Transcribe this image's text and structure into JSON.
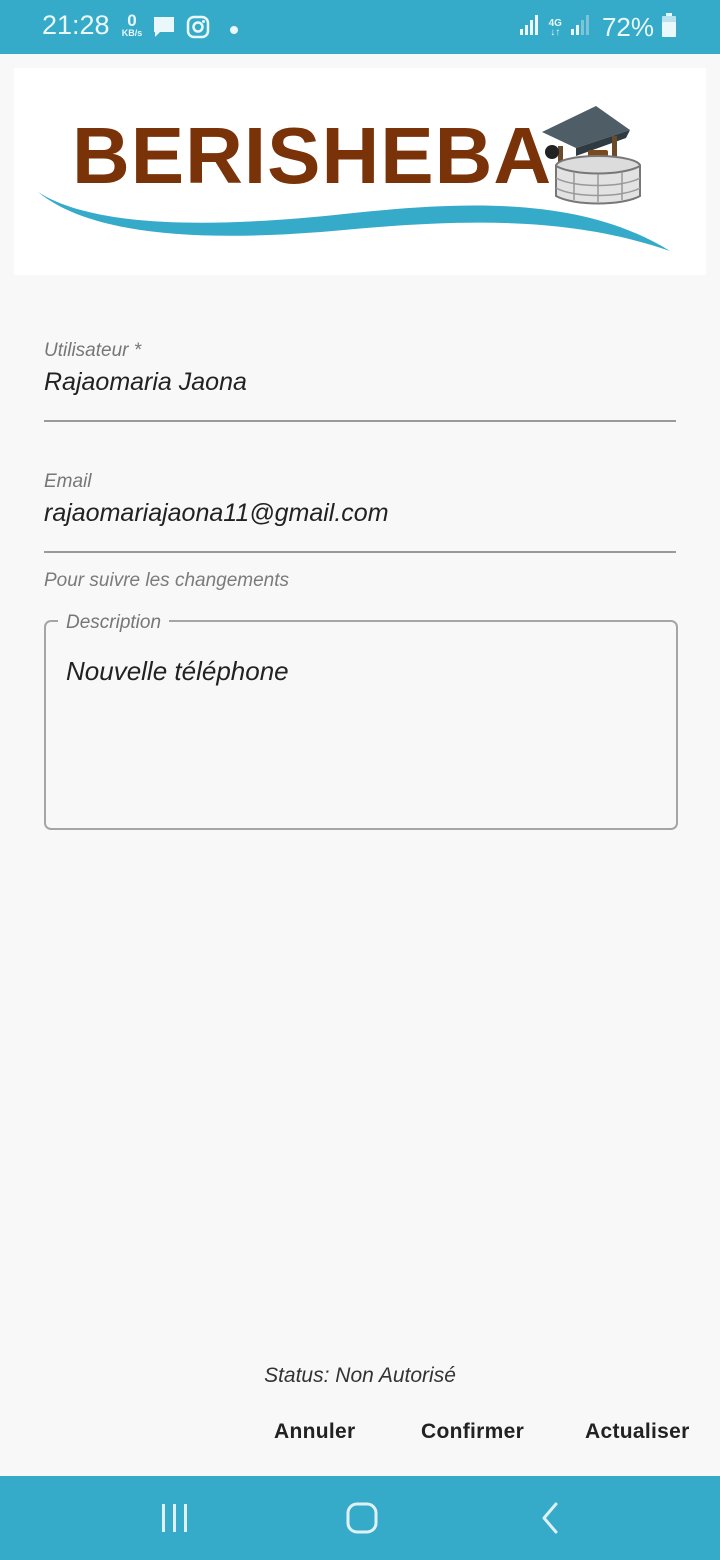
{
  "status_bar": {
    "time": "21:28",
    "net_speed_value": "0",
    "net_speed_unit": "KB/s",
    "left_icons": [
      "chat-bubble-icon",
      "instagram-icon",
      "notification-dot-icon"
    ],
    "right_icons": [
      "signal-icon",
      "4g-icon",
      "signal-weak-icon",
      "battery-icon"
    ],
    "network_type": "4G",
    "battery": "72%"
  },
  "logo": {
    "brand": "BERISHEBA",
    "colors": {
      "text": "#7a3208",
      "wave": "#36abc9"
    }
  },
  "form": {
    "user": {
      "label": "Utilisateur *",
      "value": "Rajaomaria Jaona"
    },
    "email": {
      "label": "Email",
      "value": "rajaomariajaona11@gmail.com",
      "helper": "Pour suivre les changements"
    },
    "description": {
      "label": "Description",
      "value": "Nouvelle téléphone"
    }
  },
  "status": {
    "text": "Status: Non Autorisé"
  },
  "actions": {
    "cancel": "Annuler",
    "confirm": "Confirmer",
    "refresh": "Actualiser"
  },
  "nav_bar": {
    "icons": [
      "recent-apps-icon",
      "home-icon",
      "back-icon"
    ]
  },
  "colors": {
    "accent": "#36abc9",
    "background": "#f8f8f8"
  }
}
